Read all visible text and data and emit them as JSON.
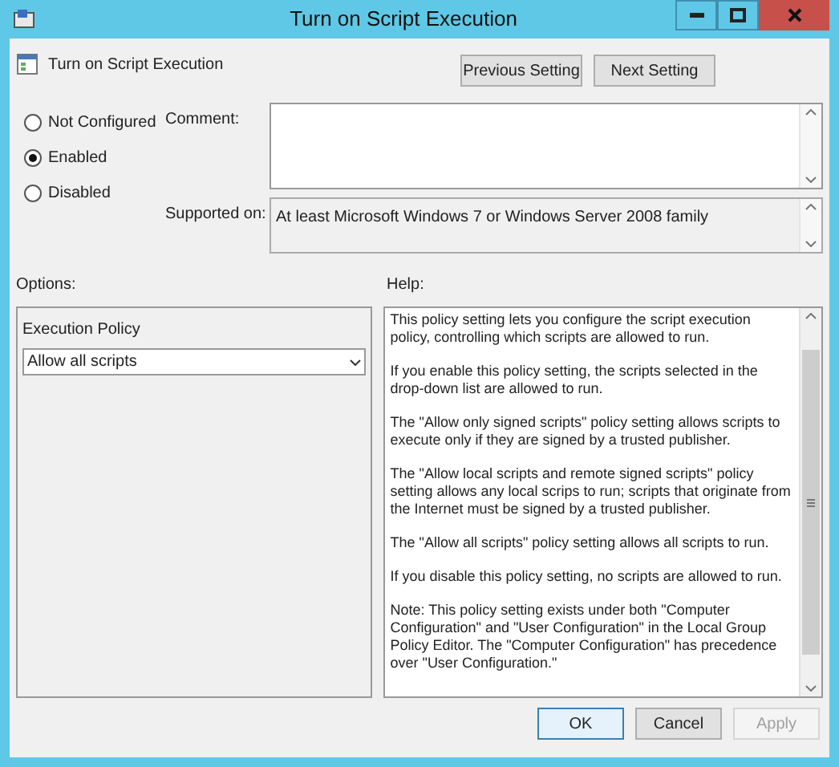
{
  "window": {
    "title": "Turn on Script Execution"
  },
  "setting_name": "Turn on Script Execution",
  "nav_buttons": [
    {
      "label": "Previous Setting"
    },
    {
      "label": "Next Setting"
    }
  ],
  "state_options": [
    {
      "label": "Not Configured",
      "selected": false
    },
    {
      "label": "Enabled",
      "selected": true
    },
    {
      "label": "Disabled",
      "selected": false
    }
  ],
  "comment": {
    "label": "Comment:"
  },
  "supported_on": {
    "label": "Supported on:",
    "value": "At least Microsoft Windows 7 or Windows Server 2008 family"
  },
  "options": {
    "label": "Options:",
    "field_label": "Execution Policy",
    "dropdown_value": "Allow all scripts"
  },
  "help": {
    "label": "Help:",
    "paragraphs": [
      "This policy setting lets you configure the script execution policy, controlling which scripts are allowed to run.",
      "If you enable this policy setting, the scripts selected in the drop-down list are allowed to run.",
      "The \"Allow only signed scripts\" policy setting allows scripts to execute only if they are signed by a trusted publisher.",
      "The \"Allow local scripts and remote signed scripts\" policy setting allows any local scrips to run; scripts that originate from the Internet must be signed by a trusted publisher.",
      "The \"Allow all scripts\" policy setting allows all scripts to run.",
      "If you disable this policy setting, no scripts are allowed to run.",
      "Note: This policy setting exists under both \"Computer Configuration\" and \"User Configuration\" in the Local Group Policy Editor. The \"Computer Configuration\" has precedence over \"User Configuration.\""
    ]
  },
  "buttons": [
    {
      "label": "OK",
      "disabled": false,
      "default": true
    },
    {
      "label": "Cancel",
      "disabled": false,
      "default": false
    },
    {
      "label": "Apply",
      "disabled": true,
      "default": false
    }
  ]
}
